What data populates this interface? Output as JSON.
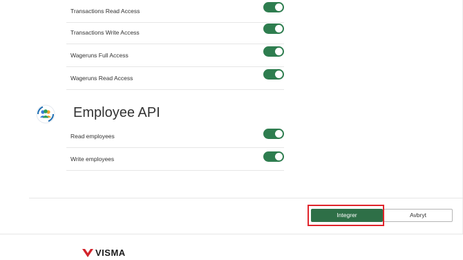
{
  "permissions_top": [
    {
      "label": "Transactions Read Access",
      "enabled": true
    },
    {
      "label": "Transactions Write Access",
      "enabled": true
    },
    {
      "label": "Wageruns Full Access",
      "enabled": true
    },
    {
      "label": "Wageruns Read Access",
      "enabled": true
    }
  ],
  "employee_api": {
    "title": "Employee API",
    "icon": "people-group-icon",
    "permissions": [
      {
        "label": "Read employees",
        "enabled": true
      },
      {
        "label": "Write employees",
        "enabled": true
      }
    ]
  },
  "footer": {
    "primary_label": "Integrer",
    "secondary_label": "Avbryt"
  },
  "brand": {
    "logo_text": "VISMA",
    "logo_color": "#d2232a"
  },
  "colors": {
    "toggle_on": "#2e7d4f",
    "primary_button": "#2e6f47",
    "highlight": "#e0242b"
  }
}
